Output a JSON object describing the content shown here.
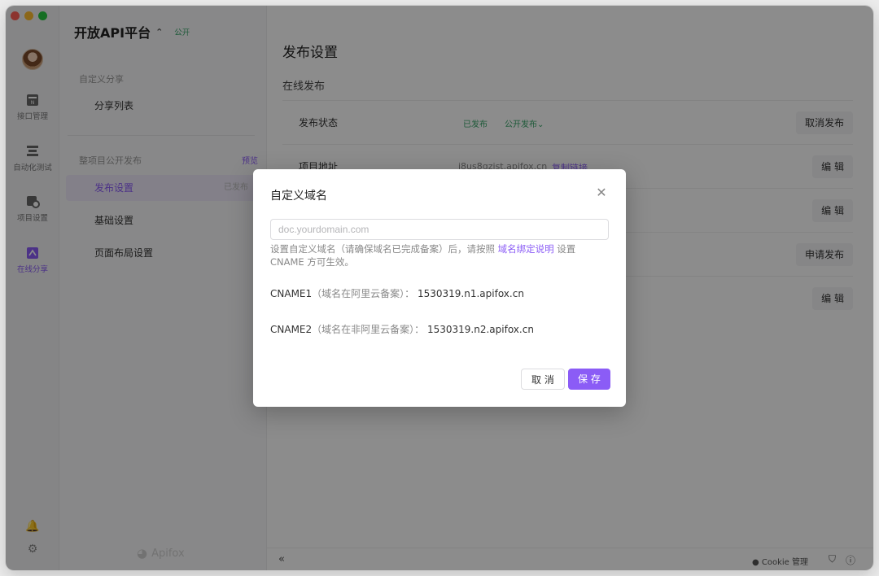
{
  "rail": {
    "items": [
      {
        "label": "接口管理",
        "icon": "api-icon"
      },
      {
        "label": "自动化测试",
        "icon": "automation-icon"
      },
      {
        "label": "项目设置",
        "icon": "settings-icon"
      },
      {
        "label": "在线分享",
        "icon": "share-icon"
      }
    ]
  },
  "sidebar": {
    "project_name": "开放API平台",
    "visibility": "公开",
    "section1": "自定义分享",
    "item_share_list": "分享列表",
    "section2": "整项目公开发布",
    "preview": "预览",
    "item_publish": "发布设置",
    "item_publish_status": "已发布",
    "item_basic": "基础设置",
    "item_layout": "页面布局设置",
    "brand": "Apifox"
  },
  "main": {
    "title": "发布设置",
    "subtitle": "在线发布",
    "rows": [
      {
        "key": "发布状态",
        "value": "已发布",
        "value2": "公开发布",
        "btn": "取消发布"
      },
      {
        "key": "项目地址",
        "value": "i8us8qzist.apifox.cn",
        "value2": "复制链接",
        "btn": "编 辑"
      },
      {
        "key": "",
        "value": "",
        "btn": "编 辑"
      },
      {
        "key": "",
        "value": "",
        "btn": "申请发布"
      },
      {
        "key": "",
        "value": "",
        "btn": "编 辑"
      }
    ]
  },
  "bottom": {
    "collapse": "«",
    "cookie": "Cookie 管理"
  },
  "modal": {
    "title": "自定义域名",
    "placeholder": "doc.yourdomain.com",
    "hint_before": "设置自定义域名（请确保域名已完成备案）后，请按照 ",
    "hint_link": "域名绑定说明",
    "hint_after": " 设置 CNAME 方可生效。",
    "cname1_label": "CNAME1",
    "cname1_note": "（域名在阿里云备案）：",
    "cname1_value": "1530319.n1.apifox.cn",
    "cname2_label": "CNAME2",
    "cname2_note": "（域名在非阿里云备案）：",
    "cname2_value": "1530319.n2.apifox.cn",
    "cancel": "取 消",
    "save": "保 存"
  },
  "colors": {
    "accent": "#8b5cf6",
    "success": "#3aa56b"
  }
}
